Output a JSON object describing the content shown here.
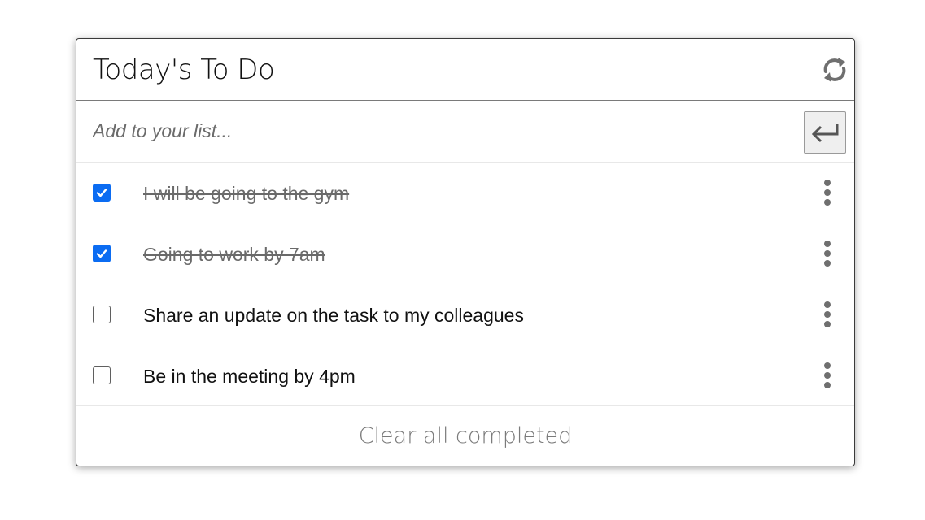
{
  "header": {
    "title": "Today's To Do",
    "refresh_icon": "refresh-icon"
  },
  "add": {
    "placeholder": "Add to your list...",
    "value": "",
    "enter_icon": "enter-arrow-icon"
  },
  "items": [
    {
      "text": "I will be going to the gym",
      "completed": true
    },
    {
      "text": "Going to work by 7am",
      "completed": true
    },
    {
      "text": "Share an update on the task to my colleagues",
      "completed": false
    },
    {
      "text": "Be in the meeting by 4pm",
      "completed": false
    }
  ],
  "footer": {
    "clear_label": "Clear all completed"
  },
  "colors": {
    "checkbox_checked": "#0b6cf2",
    "completed_text": "#6a6a6a",
    "icon_gray": "#6f6f6f"
  }
}
